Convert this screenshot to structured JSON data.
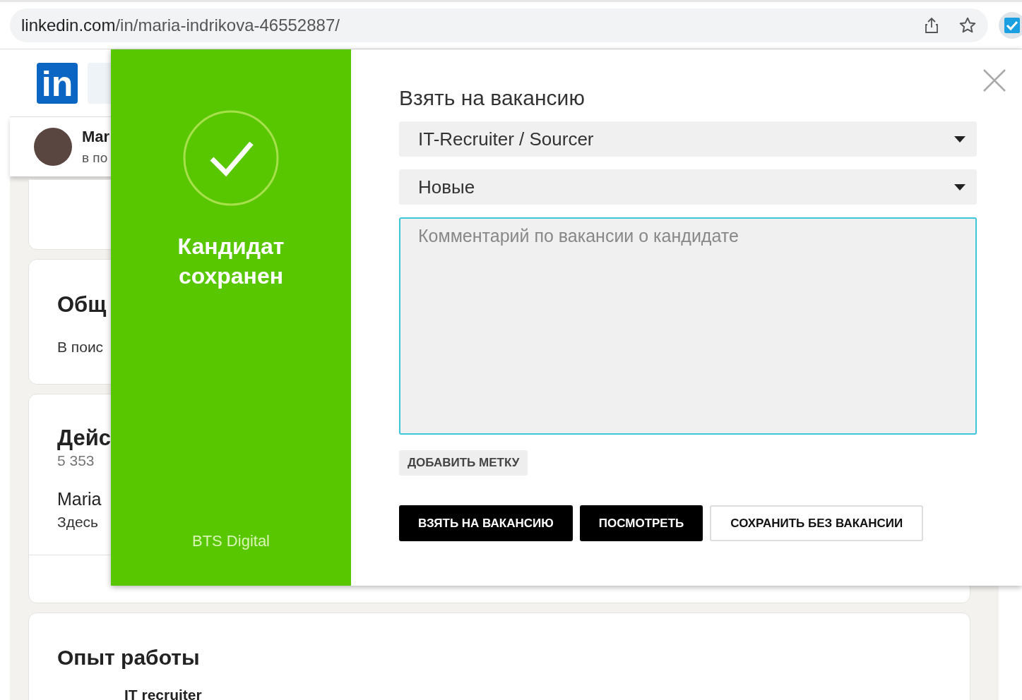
{
  "browser": {
    "url_host": "linkedin.com",
    "url_path": "/in/maria-indrikova-46552887/"
  },
  "header": {
    "logo": "in"
  },
  "profile_bar": {
    "name": "Mar",
    "subtitle": "в по"
  },
  "cards": [
    {
      "title": "Общ",
      "text": "В поис"
    },
    {
      "title": "Дейс",
      "count": "5 353",
      "name": "Maria",
      "text": "Здесь"
    },
    {
      "title": "Опыт работы",
      "item": "IT recruiter"
    }
  ],
  "popup": {
    "status": {
      "title": "Кандидат сохранен",
      "company": "BTS Digital"
    },
    "heading": "Взять на вакансию",
    "selects": [
      {
        "value": "IT-Recruiter / Sourcer"
      },
      {
        "value": "Новые"
      }
    ],
    "comment": {
      "placeholder": "Комментарий по вакансии о кандидате"
    },
    "tag_button": "ДОБАВИТЬ МЕТКУ",
    "buttons": [
      {
        "label": "ВЗЯТЬ НА ВАКАНСИЮ",
        "kind": "primary"
      },
      {
        "label": "ПОСМОТРЕТЬ",
        "kind": "primary"
      },
      {
        "label": "СОХРАНИТЬ БЕЗ ВАКАНСИИ",
        "kind": "outline"
      }
    ]
  }
}
